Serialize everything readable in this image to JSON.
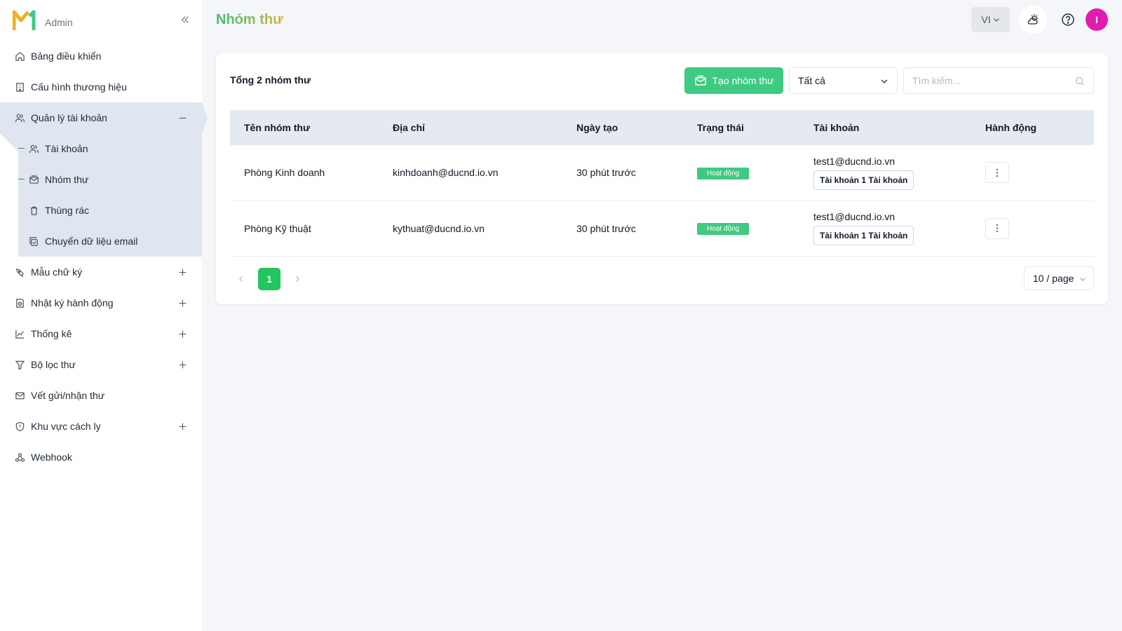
{
  "brand": {
    "name": "Admin"
  },
  "header": {
    "title": "Nhóm thư",
    "language": "VI",
    "avatar_initial": "I"
  },
  "sidebar": {
    "items": [
      {
        "label": "Bảng điều khiển",
        "icon": "home-icon"
      },
      {
        "label": "Cấu hình thương hiệu",
        "icon": "building-icon"
      },
      {
        "label": "Quản lý tài khoản",
        "icon": "users-icon",
        "expanded": true,
        "children": [
          {
            "label": "Tài khoản",
            "icon": "users-icon"
          },
          {
            "label": "Nhóm thư",
            "icon": "mail-group-icon"
          },
          {
            "label": "Thùng rác",
            "icon": "trash-icon"
          },
          {
            "label": "Chuyển dữ liệu email",
            "icon": "migrate-icon"
          }
        ]
      },
      {
        "label": "Mẫu chữ ký",
        "icon": "signature-icon"
      },
      {
        "label": "Nhật ký hành động",
        "icon": "log-icon"
      },
      {
        "label": "Thống kê",
        "icon": "chart-icon"
      },
      {
        "label": "Bộ lọc thư",
        "icon": "filter-icon"
      },
      {
        "label": "Vết gửi/nhận thư",
        "icon": "mail-icon"
      },
      {
        "label": "Khu vực cách ly",
        "icon": "shield-icon"
      },
      {
        "label": "Webhook",
        "icon": "webhook-icon"
      }
    ]
  },
  "toolbar": {
    "total_label": "Tổng 2 nhóm thư",
    "create_label": "Tạo nhóm thư",
    "filter_value": "Tất cả",
    "search_placeholder": "Tìm kiếm..."
  },
  "table": {
    "columns": [
      "Tên nhóm thư",
      "Địa chỉ",
      "Ngày tạo",
      "Trạng thái",
      "Tài khoản",
      "Hành động"
    ],
    "rows": [
      {
        "name": "Phòng Kinh doanh",
        "address": "kinhdoanh@ducnd.io.vn",
        "created": "30 phút trước",
        "status": "Hoạt động",
        "account_email": "test1@ducnd.io.vn",
        "account_tag": "Tài khoản 1 Tài khoản"
      },
      {
        "name": "Phòng Kỹ thuật",
        "address": "kythuat@ducnd.io.vn",
        "created": "30 phút trước",
        "status": "Hoạt động",
        "account_email": "test1@ducnd.io.vn",
        "account_tag": "Tài khoản 1 Tài khoản"
      }
    ]
  },
  "pagination": {
    "current_page": "1",
    "page_size": "10 / page"
  },
  "colors": {
    "accent": "#3fca82",
    "active_bg": "#dfe6ef",
    "avatar": "#e11cb0"
  }
}
